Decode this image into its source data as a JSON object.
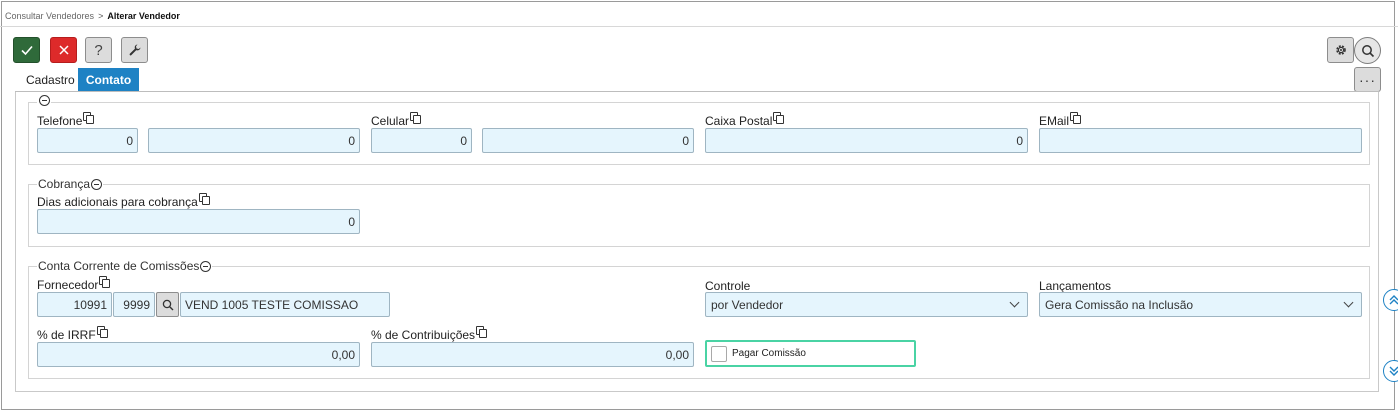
{
  "breadcrumb": {
    "parent": "Consultar Vendedores",
    "separator": ">",
    "current": "Alterar Vendedor"
  },
  "toolbar": {
    "help_label": "?",
    "more_label": "···"
  },
  "tabs": [
    {
      "label": "Cadastro",
      "active": false
    },
    {
      "label": "Contato",
      "active": true
    }
  ],
  "contact": {
    "telefone": {
      "label": "Telefone",
      "ddd": "0",
      "numero": "0"
    },
    "celular": {
      "label": "Celular",
      "ddd": "0",
      "numero": "0"
    },
    "caixa_postal": {
      "label": "Caixa Postal",
      "value": "0"
    },
    "email": {
      "label": "EMail",
      "value": ""
    }
  },
  "cobranca": {
    "legend": "Cobrança",
    "dias_label": "Dias adicionais para cobrança",
    "dias_value": "0"
  },
  "comissoes": {
    "legend": "Conta Corrente de Comissões",
    "fornecedor": {
      "label": "Fornecedor",
      "codigo": "10991",
      "loja": "9999",
      "nome": "VEND 1005 TESTE COMISSAO"
    },
    "controle": {
      "label": "Controle",
      "value": "por Vendedor"
    },
    "lancamentos": {
      "label": "Lançamentos",
      "value": "Gera Comissão na Inclusão"
    },
    "irrf": {
      "label": "% de IRRF",
      "value": "0,00"
    },
    "contribuicoes": {
      "label": "% de Contribuições",
      "value": "0,00"
    },
    "pagar_comissao": {
      "label": "Pagar Comissão",
      "checked": false
    }
  },
  "colors": {
    "accent": "#1e82c4",
    "confirm": "#2f6a3a",
    "cancel": "#dd2a2a",
    "input_bg": "#e5f5fd",
    "focus": "#4ad3a4"
  }
}
